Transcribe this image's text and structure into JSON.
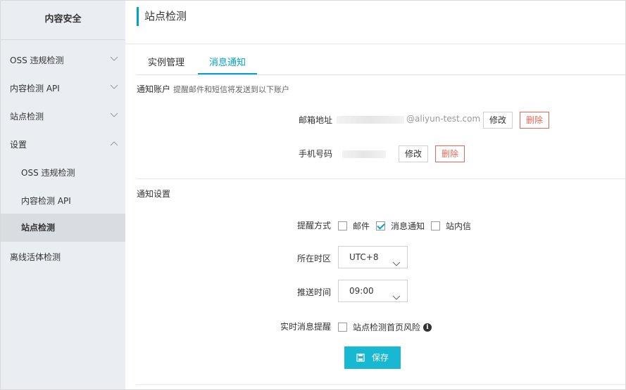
{
  "sidebar": {
    "title": "内容安全",
    "items": [
      {
        "label": "OSS 违规检测",
        "chevron": "down"
      },
      {
        "label": "内容检测 API",
        "chevron": "down"
      },
      {
        "label": "站点检测",
        "chevron": "down"
      },
      {
        "label": "设置",
        "chevron": "up"
      },
      {
        "label": "OSS 违规检测"
      },
      {
        "label": "内容检测 API"
      },
      {
        "label": "站点检测",
        "active": true
      },
      {
        "label": "离线活体检测"
      }
    ]
  },
  "header": {
    "title": "站点检测",
    "accent_color": "#00a2ca"
  },
  "tabs": [
    {
      "label": "实例管理"
    },
    {
      "label": "消息通知",
      "active": true
    }
  ],
  "notify_account": {
    "title": "通知账户",
    "subtitle": "提醒邮件和短信将发送到以下账户",
    "email_label": "邮箱地址",
    "email_domain": "@aliyun-test.com",
    "phone_label": "手机号码",
    "edit_label": "修改",
    "delete_label": "删除"
  },
  "notify_settings": {
    "title": "通知设置",
    "method_label": "提醒方式",
    "methods": [
      {
        "label": "邮件",
        "checked": false
      },
      {
        "label": "消息通知",
        "checked": true
      },
      {
        "label": "站内信",
        "checked": false
      }
    ],
    "timezone_label": "所在时区",
    "timezone_value": "UTC+8",
    "push_time_label": "推送时间",
    "push_time_value": "09:00",
    "realtime_label": "实时消息提醒",
    "realtime_option": "站点检测首页风险",
    "realtime_checked": false,
    "info_icon": "info-icon",
    "save_label": "保存"
  }
}
